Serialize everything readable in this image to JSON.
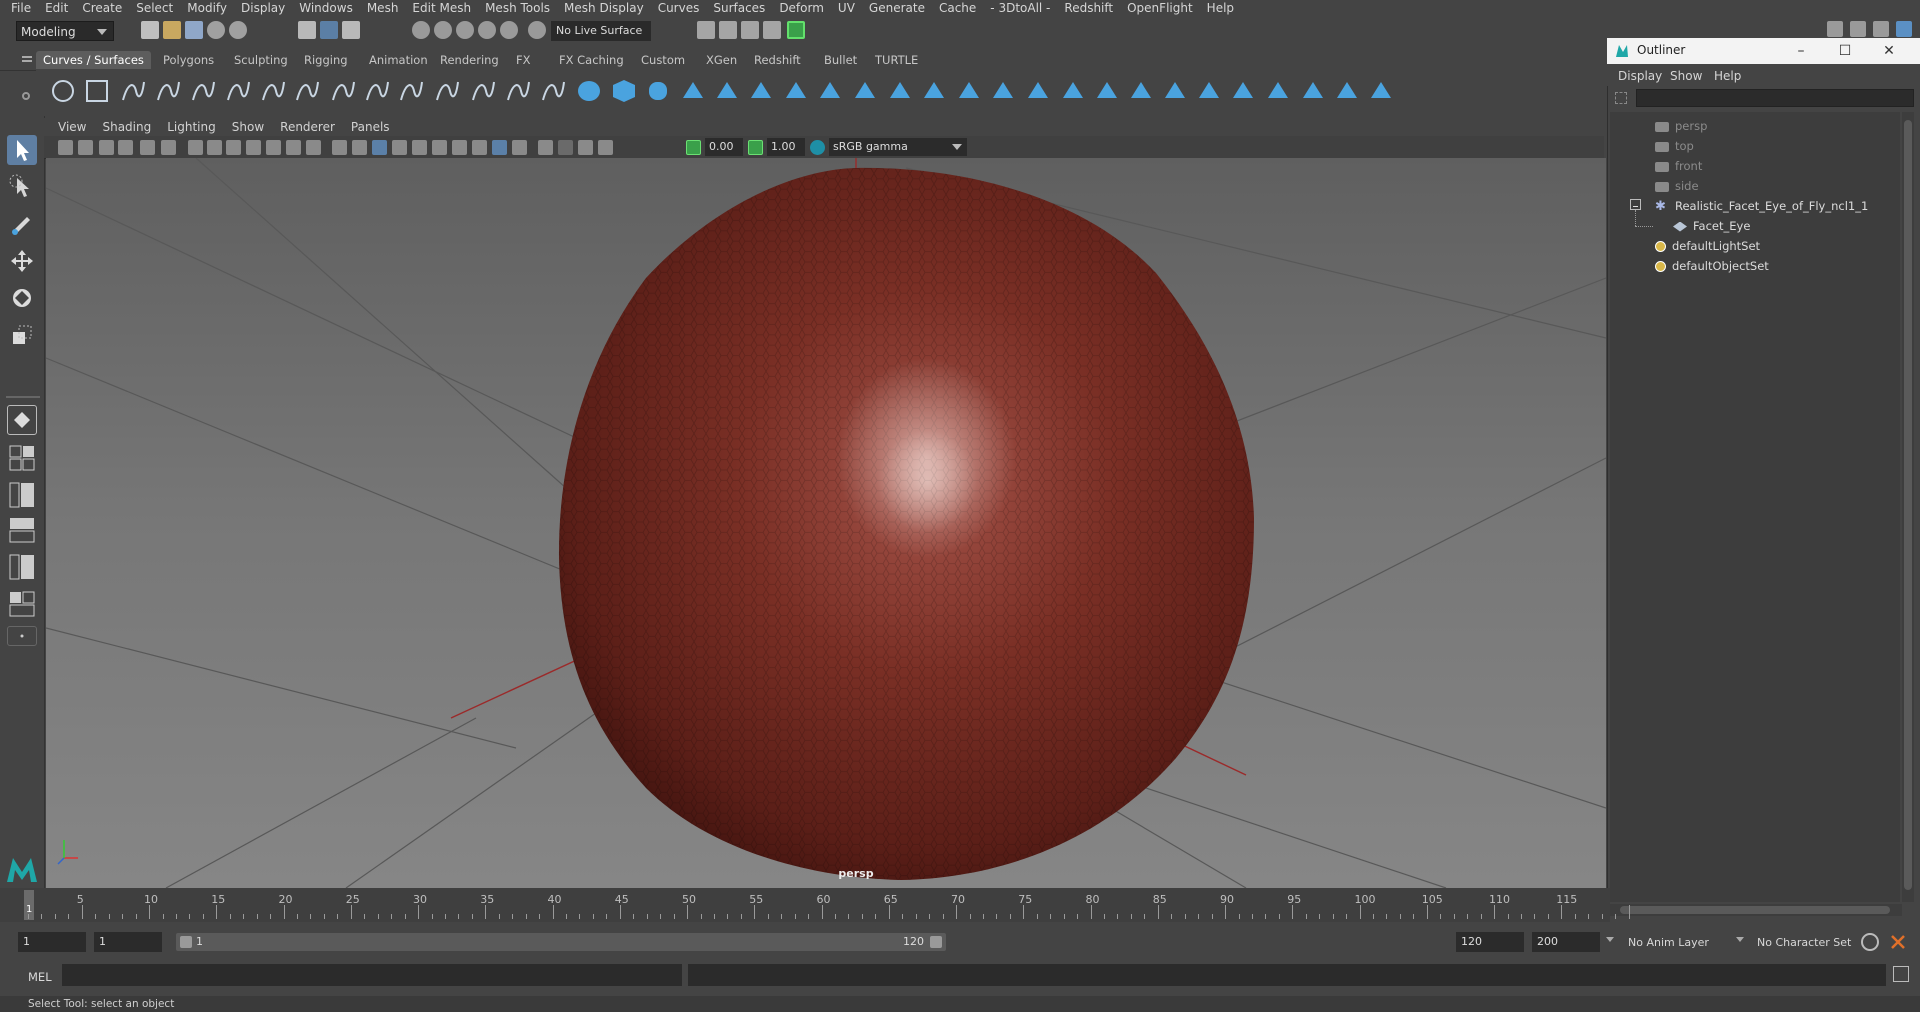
{
  "menubar": {
    "items": [
      "File",
      "Edit",
      "Create",
      "Select",
      "Modify",
      "Display",
      "Windows",
      "Mesh",
      "Edit Mesh",
      "Mesh Tools",
      "Mesh Display",
      "Curves",
      "Surfaces",
      "Deform",
      "UV",
      "Generate",
      "Cache",
      "- 3DtoAll -",
      "Redshift",
      "OpenFlight",
      "Help"
    ]
  },
  "statusline": {
    "mode": "Modeling",
    "live_surface": "No Live Surface"
  },
  "shelf_tabs": {
    "items": [
      "Curves / Surfaces",
      "Polygons",
      "Sculpting",
      "Rigging",
      "Animation",
      "Rendering",
      "FX",
      "FX Caching",
      "Custom",
      "XGen",
      "Redshift",
      "Bullet",
      "TURTLE"
    ],
    "active": "Curves / Surfaces"
  },
  "viewport": {
    "menu": [
      "View",
      "Shading",
      "Lighting",
      "Show",
      "Renderer",
      "Panels"
    ],
    "exposure": "0.00",
    "gamma": "1.00",
    "color_space": "sRGB gamma",
    "camera_label": "persp",
    "object_color": "#7a2e24",
    "grid_color": "#5a5a5a"
  },
  "outliner": {
    "title": "Outliner",
    "menu": [
      "Display",
      "Show",
      "Help"
    ],
    "items": [
      {
        "label": "persp",
        "icon": "camera-icon",
        "dim": true
      },
      {
        "label": "top",
        "icon": "camera-icon",
        "dim": true
      },
      {
        "label": "front",
        "icon": "camera-icon",
        "dim": true
      },
      {
        "label": "side",
        "icon": "camera-icon",
        "dim": true
      },
      {
        "label": "Realistic_Facet_Eye_of_Fly_ncl1_1",
        "icon": "group-icon",
        "dim": false
      },
      {
        "label": "Facet_Eye",
        "icon": "mesh-icon",
        "dim": false
      },
      {
        "label": "defaultLightSet",
        "icon": "set-icon",
        "dim": false
      },
      {
        "label": "defaultObjectSet",
        "icon": "set-icon",
        "dim": false
      }
    ]
  },
  "timeslider": {
    "ticks": [
      "5",
      "10",
      "15",
      "20",
      "25",
      "30",
      "35",
      "40",
      "45",
      "50",
      "55",
      "60",
      "65",
      "70",
      "75",
      "80",
      "85",
      "90",
      "95",
      "100",
      "105",
      "110",
      "115"
    ],
    "current_frame": "1"
  },
  "rangebar": {
    "start_frame": "1",
    "playback_start": "1",
    "range_start_label": "1",
    "range_end_label": "120",
    "playback_end": "120",
    "end_frame": "200",
    "anim_layer": "No Anim Layer",
    "character_set": "No Character Set"
  },
  "cmdline": {
    "label": "MEL"
  },
  "helpline": {
    "text": "Select Tool: select an object"
  }
}
